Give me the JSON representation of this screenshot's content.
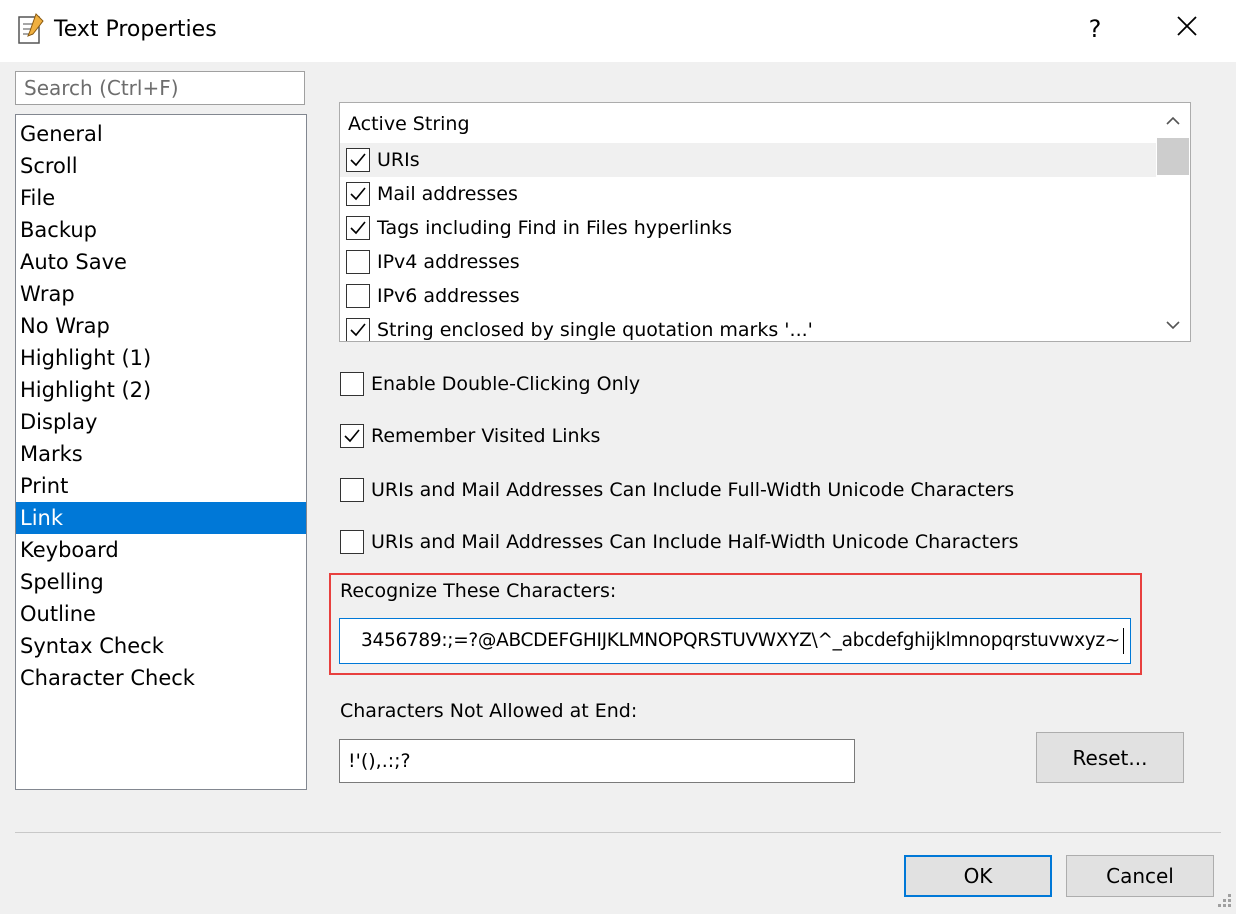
{
  "window": {
    "title": "Text Properties",
    "help_label": "?",
    "close_label": "✕"
  },
  "search": {
    "placeholder": "Search (Ctrl+F)"
  },
  "categories": [
    {
      "label": "General",
      "selected": false
    },
    {
      "label": "Scroll",
      "selected": false
    },
    {
      "label": "File",
      "selected": false
    },
    {
      "label": "Backup",
      "selected": false
    },
    {
      "label": "Auto Save",
      "selected": false
    },
    {
      "label": "Wrap",
      "selected": false
    },
    {
      "label": "No Wrap",
      "selected": false
    },
    {
      "label": "Highlight (1)",
      "selected": false
    },
    {
      "label": "Highlight (2)",
      "selected": false
    },
    {
      "label": "Display",
      "selected": false
    },
    {
      "label": "Marks",
      "selected": false
    },
    {
      "label": "Print",
      "selected": false
    },
    {
      "label": "Link",
      "selected": true
    },
    {
      "label": "Keyboard",
      "selected": false
    },
    {
      "label": "Spelling",
      "selected": false
    },
    {
      "label": "Outline",
      "selected": false
    },
    {
      "label": "Syntax Check",
      "selected": false
    },
    {
      "label": "Character Check",
      "selected": false
    }
  ],
  "active_string": {
    "header": "Active String",
    "items": [
      {
        "label": "URIs",
        "checked": true
      },
      {
        "label": "Mail addresses",
        "checked": true
      },
      {
        "label": "Tags including Find in Files hyperlinks",
        "checked": true
      },
      {
        "label": "IPv4 addresses",
        "checked": false
      },
      {
        "label": "IPv6 addresses",
        "checked": false
      },
      {
        "label": "String enclosed by single quotation marks '...'",
        "checked": true
      }
    ]
  },
  "options": {
    "double_click": {
      "label": "Enable Double-Clicking Only",
      "checked": false
    },
    "remember_visited": {
      "label": "Remember Visited Links",
      "checked": true
    },
    "full_width": {
      "label": "URIs and Mail Addresses Can Include Full-Width Unicode Characters",
      "checked": false
    },
    "half_width": {
      "label": "URIs and Mail Addresses Can Include Half-Width Unicode Characters",
      "checked": false
    }
  },
  "recognize": {
    "label": "Recognize These Characters:",
    "value": "3456789:;=?@ABCDEFGHIJKLMNOPQRSTUVWXYZ\\^_abcdefghijklmnopqrstuvwxyz~"
  },
  "not_allowed_end": {
    "label": "Characters Not Allowed at End:",
    "value": "!'(),.:;?"
  },
  "buttons": {
    "reset": "Reset...",
    "ok": "OK",
    "cancel": "Cancel"
  },
  "colors": {
    "selection": "#0078d7",
    "highlight_frame": "#e8403e"
  }
}
